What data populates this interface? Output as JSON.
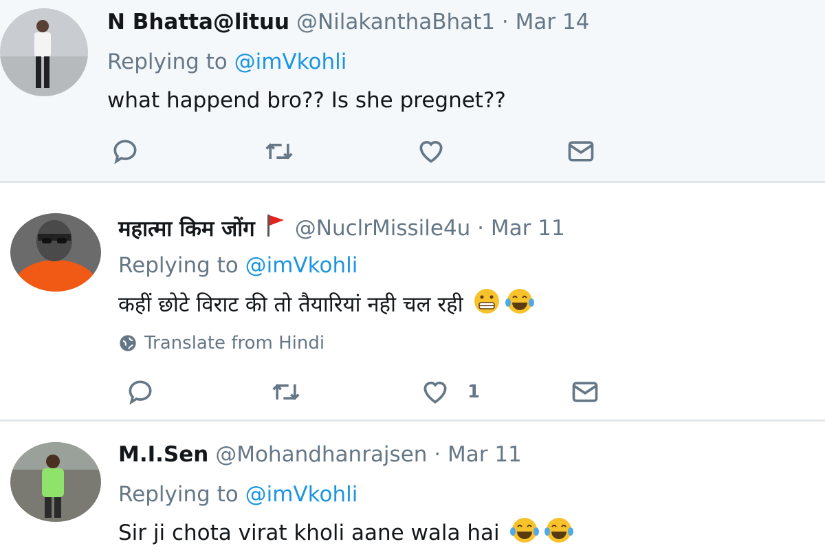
{
  "tweets": [
    {
      "name": "N Bhatta@lituu",
      "handle": "@NilakanthaBhat1",
      "sep": " · ",
      "date": "Mar 14",
      "replying_prefix": "Replying to ",
      "replying_handle": "@imVkohli",
      "text": "what happend  bro?? Is she pregnet??",
      "actions": {
        "reply_icon": "reply-icon",
        "retweet_icon": "retweet-icon",
        "like_icon": "heart-icon",
        "dm_icon": "mail-icon"
      }
    },
    {
      "name": "महात्मा किम जोंग",
      "name_badge_icon": "red-flag-icon",
      "handle": "@NuclrMissile4u",
      "sep": " · ",
      "date": "Mar 11",
      "replying_prefix": "Replying to ",
      "replying_handle": "@imVkohli",
      "text": "कहीं छोटे विराट की तो तैयारियां नही चल रही",
      "text_emojis": [
        "grimacing-face-emoji",
        "laughing-tears-emoji"
      ],
      "translate": "Translate from Hindi",
      "translate_icon": "globe-icon",
      "like_count": "1",
      "actions": {
        "reply_icon": "reply-icon",
        "retweet_icon": "retweet-icon",
        "like_icon": "heart-icon",
        "dm_icon": "mail-icon"
      }
    },
    {
      "name": "M.I.Sen",
      "handle": "@Mohandhanrajsen",
      "sep": " · ",
      "date": "Mar 11",
      "replying_prefix": "Replying to ",
      "replying_handle": "@imVkohli",
      "text": "Sir ji chota virat kholi aane wala hai",
      "text_emojis": [
        "laughing-tears-emoji",
        "laughing-tears-emoji"
      ]
    }
  ],
  "colors": {
    "link": "#1b95e0",
    "muted": "#657786",
    "text": "#14171a",
    "highlight_bg": "#f5f8fa",
    "divider": "#e1e8ed"
  }
}
